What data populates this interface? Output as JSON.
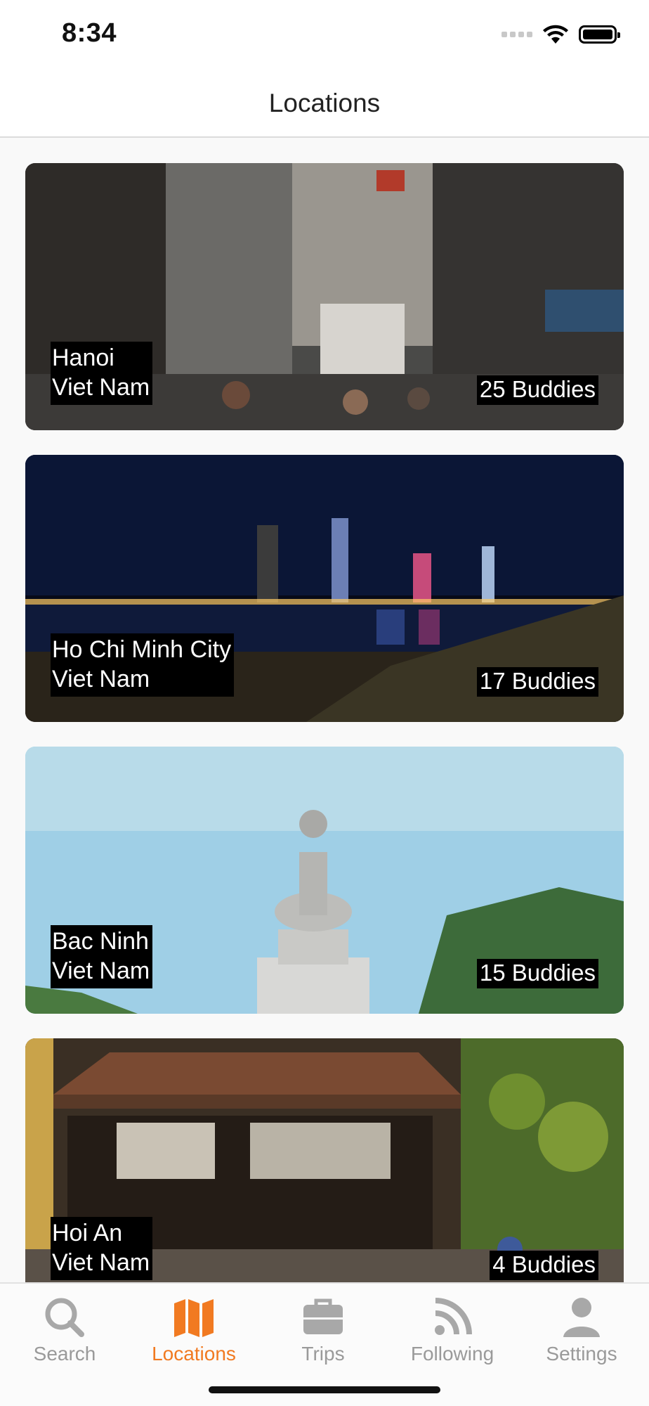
{
  "status": {
    "time": "8:34"
  },
  "header": {
    "title": "Locations"
  },
  "locations": [
    {
      "city": "Hanoi",
      "country": "Viet Nam",
      "buddies": "25 Buddies"
    },
    {
      "city": "Ho Chi Minh City",
      "country": "Viet Nam",
      "buddies": "17 Buddies"
    },
    {
      "city": "Bac Ninh",
      "country": "Viet Nam",
      "buddies": "15 Buddies"
    },
    {
      "city": "Hoi An",
      "country": "Viet Nam",
      "buddies": "4 Buddies"
    }
  ],
  "tabs": [
    {
      "label": "Search",
      "icon": "search-icon"
    },
    {
      "label": "Locations",
      "icon": "map-icon",
      "active": true
    },
    {
      "label": "Trips",
      "icon": "briefcase-icon"
    },
    {
      "label": "Following",
      "icon": "feed-icon"
    },
    {
      "label": "Settings",
      "icon": "person-icon"
    }
  ],
  "colors": {
    "accent": "#f17a21",
    "inactive": "#9a9a9a"
  }
}
